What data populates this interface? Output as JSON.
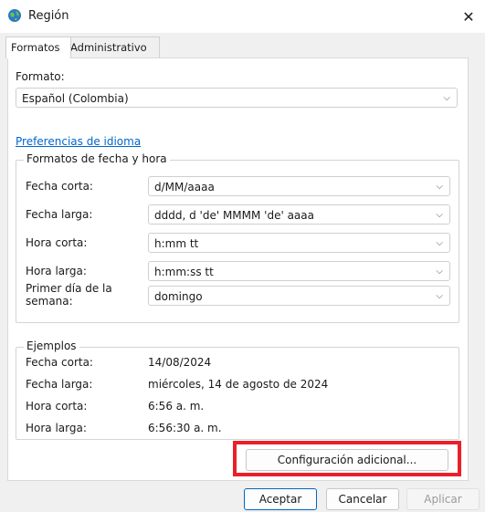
{
  "window": {
    "title": "Región"
  },
  "tabs": [
    {
      "label": "Formatos",
      "active": true
    },
    {
      "label": "Administrativo",
      "active": false
    }
  ],
  "format": {
    "label": "Formato:",
    "value": "Español (Colombia)"
  },
  "language_link": "Preferencias de idioma",
  "date_time_formats": {
    "title": "Formatos de fecha y hora",
    "fields": [
      {
        "label": "Fecha corta:",
        "value": "d/MM/aaaa"
      },
      {
        "label": "Fecha larga:",
        "value": "dddd, d 'de' MMMM 'de' aaaa"
      },
      {
        "label": "Hora corta:",
        "value": "h:mm tt"
      },
      {
        "label": "Hora larga:",
        "value": "h:mm:ss tt"
      },
      {
        "label": "Primer día de la semana:",
        "value": "domingo"
      }
    ]
  },
  "examples": {
    "title": "Ejemplos",
    "rows": [
      {
        "label": "Fecha corta:",
        "value": "14/08/2024"
      },
      {
        "label": "Fecha larga:",
        "value": "miércoles, 14 de agosto de 2024"
      },
      {
        "label": "Hora corta:",
        "value": "6:56 a. m."
      },
      {
        "label": "Hora larga:",
        "value": "6:56:30 a. m."
      }
    ]
  },
  "buttons": {
    "additional": "Configuración adicional...",
    "accept": "Aceptar",
    "cancel": "Cancelar",
    "apply": "Aplicar"
  },
  "colors": {
    "accent": "#0067c0",
    "highlight": "#e8202a",
    "link": "#0066cc"
  },
  "icons": {
    "title": "globe-icon",
    "close": "close-icon",
    "dropdown": "chevron-down-icon"
  }
}
